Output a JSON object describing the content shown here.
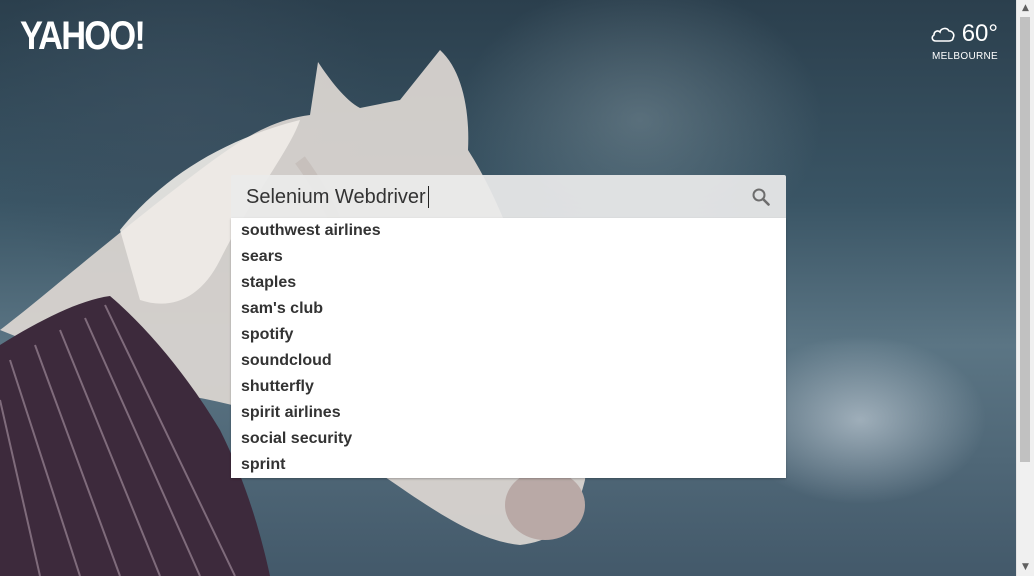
{
  "logo": {
    "text": "YAHOO!"
  },
  "weather": {
    "icon": "cloud-icon",
    "temperature": "60°",
    "city": "MELBOURNE"
  },
  "search": {
    "query": "Selenium Webdriver",
    "icon": "search-icon",
    "suggestions": [
      "southwest airlines",
      "sears",
      "staples",
      "sam's club",
      "spotify",
      "soundcloud",
      "shutterfly",
      "spirit airlines",
      "social security",
      "sprint"
    ]
  }
}
